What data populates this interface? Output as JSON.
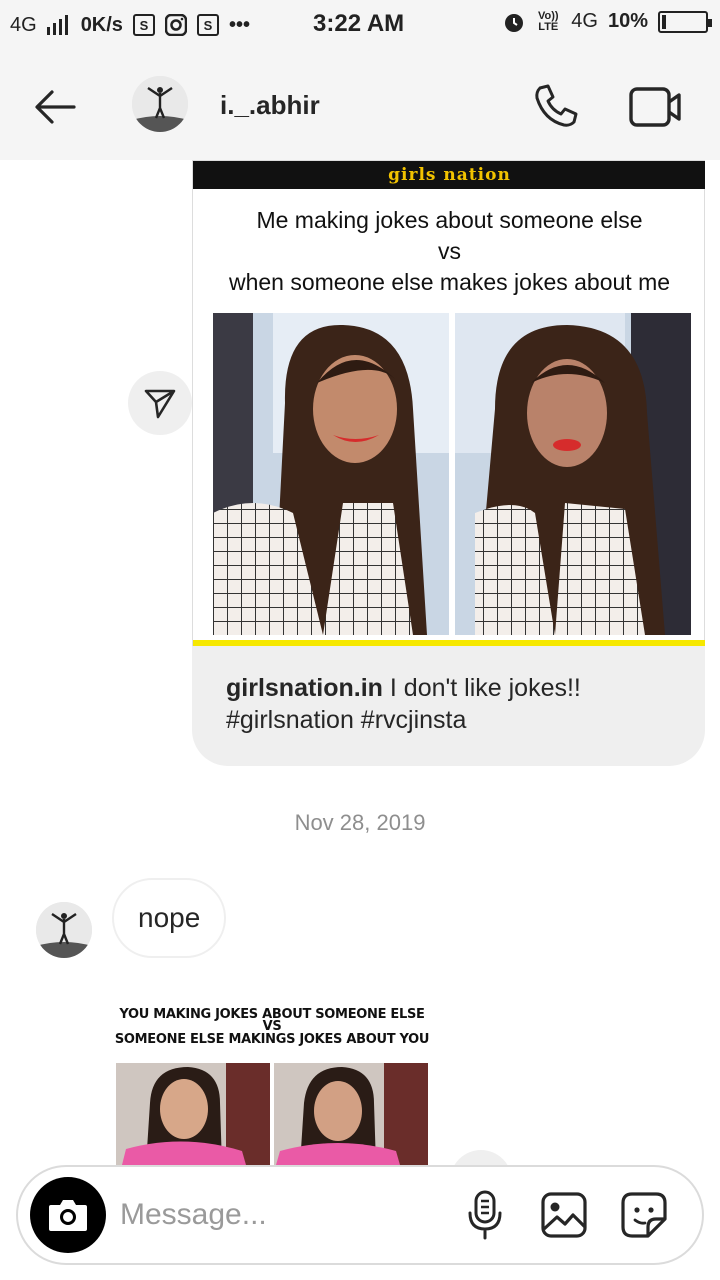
{
  "status_bar": {
    "network": "4G",
    "speed": "0K/s",
    "time": "3:22 AM",
    "volte": "Vo)) LTE",
    "network2": "4G",
    "battery": "10%"
  },
  "header": {
    "username": "i._.abhir"
  },
  "shared_post": {
    "logo_text": "girls nation",
    "meme_lines": [
      "Me making jokes about someone else",
      "vs",
      "when someone else makes jokes about me"
    ],
    "caption_user": "girlsnation.in",
    "caption_text": " I don't like jokes!! #girlsnation #rvcjinsta"
  },
  "date_separator": "Nov 28, 2019",
  "messages": [
    {
      "text": "nope"
    }
  ],
  "second_meme": {
    "line1": "YOU MAKING JOKES ABOUT SOMEONE ELSE",
    "line2": "VS",
    "line3": "SOMEONE ELSE MAKINGS JOKES ABOUT YOU"
  },
  "composer": {
    "placeholder": "Message..."
  },
  "colors": {
    "bubble_gray": "#efefef",
    "date_gray": "#8e8e8e",
    "accent_yellow": "#f6e800"
  }
}
